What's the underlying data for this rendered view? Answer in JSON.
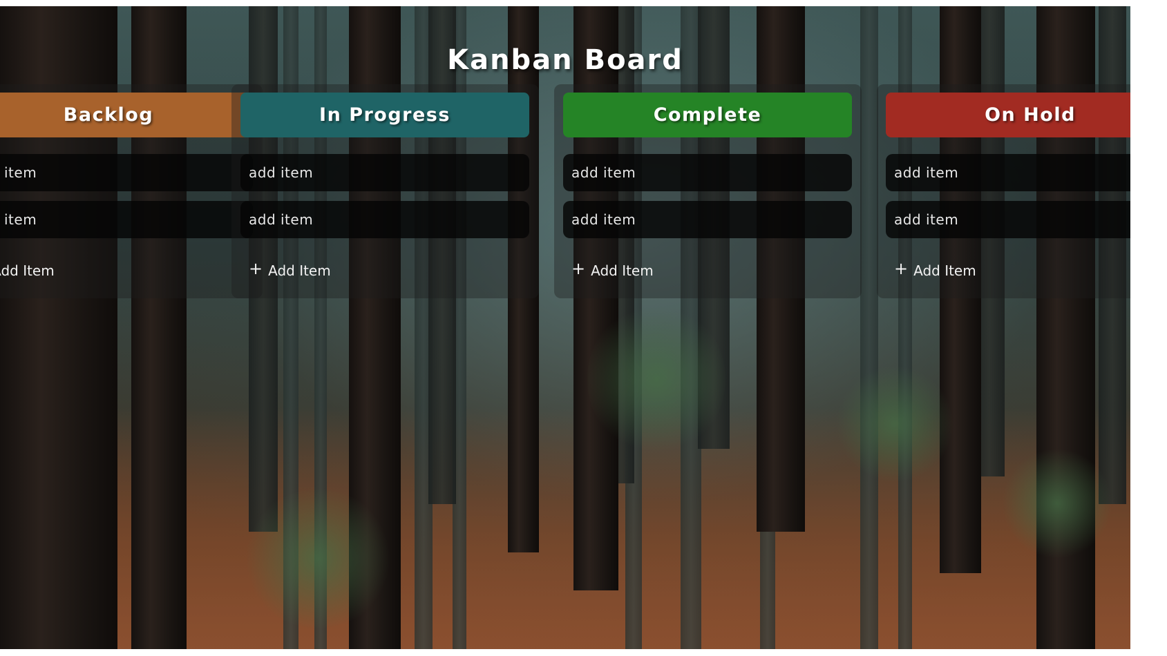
{
  "page": {
    "title": "Kanban Board"
  },
  "columns": [
    {
      "title": "Backlog",
      "color": "#a8622c",
      "items": [
        "add item",
        "add item"
      ],
      "add_label": "Add Item"
    },
    {
      "title": "In Progress",
      "color": "#1f6466",
      "items": [
        "add item",
        "add item"
      ],
      "add_label": "Add Item"
    },
    {
      "title": "Complete",
      "color": "#258426",
      "items": [
        "add item",
        "add item"
      ],
      "add_label": "Add Item"
    },
    {
      "title": "On Hold",
      "color": "#a22b22",
      "items": [
        "add item",
        "add item"
      ],
      "add_label": "Add Item"
    }
  ],
  "icons": {
    "add": "plus-icon"
  }
}
